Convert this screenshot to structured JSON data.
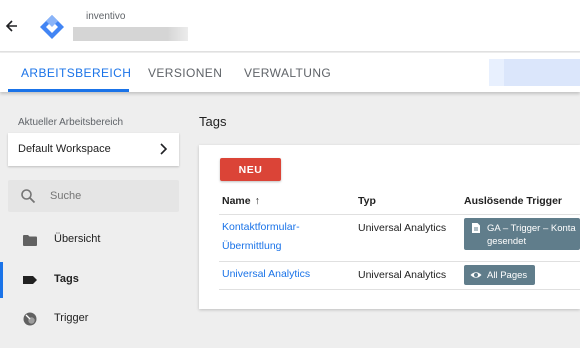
{
  "header": {
    "account_name": "inventivo"
  },
  "tabs": [
    {
      "label": "ARBEITSBEREICH",
      "active": true
    },
    {
      "label": "VERSIONEN",
      "active": false
    },
    {
      "label": "VERWALTUNG",
      "active": false
    }
  ],
  "sidebar": {
    "workspace_label": "Aktueller Arbeitsbereich",
    "workspace_name": "Default Workspace",
    "search_placeholder": "Suche",
    "items": [
      {
        "label": "Übersicht",
        "icon": "folder-icon",
        "active": false
      },
      {
        "label": "Tags",
        "icon": "tag-icon",
        "active": true
      },
      {
        "label": "Trigger",
        "icon": "trigger-icon",
        "active": false
      }
    ]
  },
  "main": {
    "title": "Tags",
    "new_button": "NEU",
    "columns": {
      "name": "Name",
      "type": "Typ",
      "triggers": "Auslösende Trigger"
    },
    "rows": [
      {
        "name_line1": "Kontaktformular-",
        "name_line2": "Übermittlung",
        "type": "Universal Analytics",
        "trigger_line1": "GA – Trigger – Konta",
        "trigger_line2": "gesendet",
        "trigger_icon": "document-icon"
      },
      {
        "name_line1": "Universal Analytics",
        "type": "Universal Analytics",
        "trigger_line1": "All Pages",
        "trigger_icon": "eye-icon"
      }
    ]
  },
  "colors": {
    "accent": "#1a73e8",
    "new_button": "#db4437",
    "chip": "#607d8b"
  }
}
